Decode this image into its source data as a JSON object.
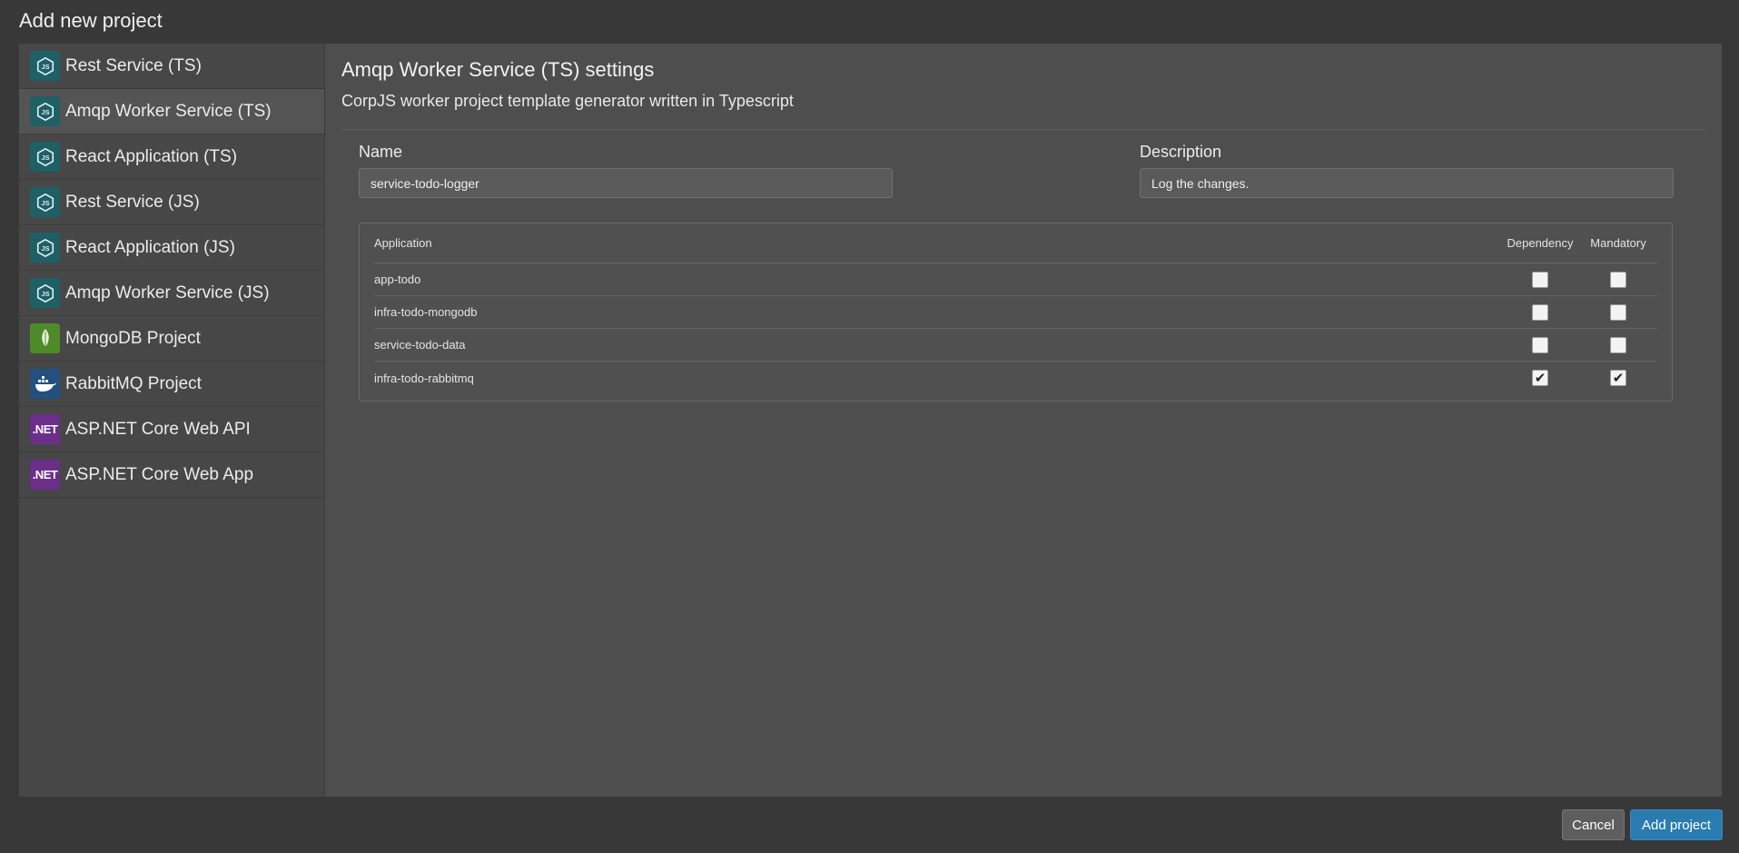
{
  "dialog": {
    "title": "Add new project"
  },
  "templates": [
    {
      "label": "Rest Service (TS)",
      "icon": "nodejs-icon"
    },
    {
      "label": "Amqp Worker Service (TS)",
      "icon": "nodejs-icon"
    },
    {
      "label": "React Application (TS)",
      "icon": "nodejs-icon"
    },
    {
      "label": "Rest Service (JS)",
      "icon": "nodejs-icon"
    },
    {
      "label": "React Application (JS)",
      "icon": "nodejs-icon"
    },
    {
      "label": "Amqp Worker Service (JS)",
      "icon": "nodejs-icon"
    },
    {
      "label": "MongoDB Project",
      "icon": "mongodb-leaf-icon"
    },
    {
      "label": "RabbitMQ Project",
      "icon": "docker-whale-icon"
    },
    {
      "label": "ASP.NET Core Web API",
      "icon": "dotnet-icon",
      "icon_text": ".NET"
    },
    {
      "label": "ASP.NET Core Web App",
      "icon": "dotnet-icon",
      "icon_text": ".NET"
    }
  ],
  "settings": {
    "title": "Amqp Worker Service (TS) settings",
    "subtitle": "CorpJS worker project template generator written in Typescript",
    "name_label": "Name",
    "name_value": "service-todo-logger",
    "description_label": "Description",
    "description_value": "Log the changes.",
    "table": {
      "headers": {
        "application": "Application",
        "dependency": "Dependency",
        "mandatory": "Mandatory"
      },
      "rows": [
        {
          "application": "app-todo",
          "dependency": false,
          "mandatory": false
        },
        {
          "application": "infra-todo-mongodb",
          "dependency": false,
          "mandatory": false
        },
        {
          "application": "service-todo-data",
          "dependency": false,
          "mandatory": false
        },
        {
          "application": "infra-todo-rabbitmq",
          "dependency": true,
          "mandatory": true
        }
      ]
    }
  },
  "footer": {
    "cancel_label": "Cancel",
    "add_label": "Add project"
  },
  "colors": {
    "background": "#383838",
    "sidebar": "#474747",
    "content": "#4e4e4e",
    "primary_button": "#2a7bb0"
  }
}
